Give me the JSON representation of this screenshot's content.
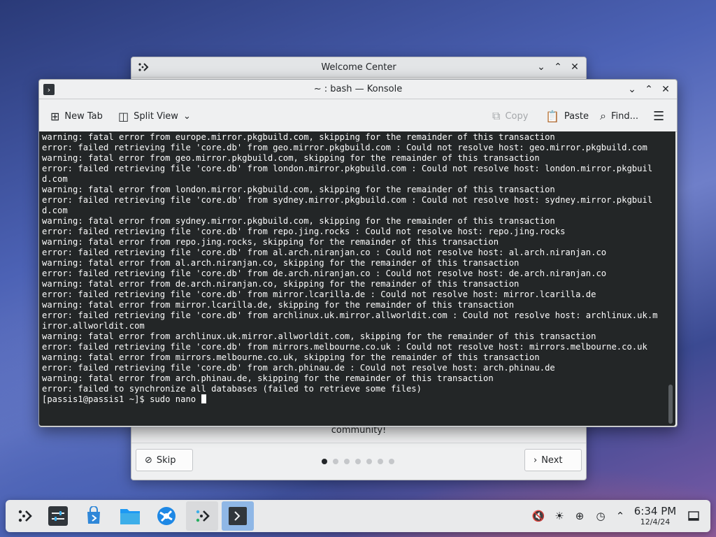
{
  "welcome": {
    "title": "Welcome Center",
    "visible_text": "community!",
    "skip_label": "Skip",
    "next_label": "Next",
    "pages": 7,
    "current_page": 1
  },
  "konsole": {
    "title": "~ : bash — Konsole",
    "toolbar": {
      "new_tab": "New Tab",
      "split_view": "Split View",
      "copy": "Copy",
      "paste": "Paste",
      "find": "Find..."
    },
    "terminal_lines": [
      "warning: fatal error from europe.mirror.pkgbuild.com, skipping for the remainder of this transaction",
      "error: failed retrieving file 'core.db' from geo.mirror.pkgbuild.com : Could not resolve host: geo.mirror.pkgbuild.com",
      "warning: fatal error from geo.mirror.pkgbuild.com, skipping for the remainder of this transaction",
      "error: failed retrieving file 'core.db' from london.mirror.pkgbuild.com : Could not resolve host: london.mirror.pkgbuild.com",
      "warning: fatal error from london.mirror.pkgbuild.com, skipping for the remainder of this transaction",
      "error: failed retrieving file 'core.db' from sydney.mirror.pkgbuild.com : Could not resolve host: sydney.mirror.pkgbuild.com",
      "warning: fatal error from sydney.mirror.pkgbuild.com, skipping for the remainder of this transaction",
      "error: failed retrieving file 'core.db' from repo.jing.rocks : Could not resolve host: repo.jing.rocks",
      "warning: fatal error from repo.jing.rocks, skipping for the remainder of this transaction",
      "error: failed retrieving file 'core.db' from al.arch.niranjan.co : Could not resolve host: al.arch.niranjan.co",
      "warning: fatal error from al.arch.niranjan.co, skipping for the remainder of this transaction",
      "error: failed retrieving file 'core.db' from de.arch.niranjan.co : Could not resolve host: de.arch.niranjan.co",
      "warning: fatal error from de.arch.niranjan.co, skipping for the remainder of this transaction",
      "error: failed retrieving file 'core.db' from mirror.lcarilla.de : Could not resolve host: mirror.lcarilla.de",
      "warning: fatal error from mirror.lcarilla.de, skipping for the remainder of this transaction",
      "error: failed retrieving file 'core.db' from archlinux.uk.mirror.allworldit.com : Could not resolve host: archlinux.uk.mirror.allworldit.com",
      "warning: fatal error from archlinux.uk.mirror.allworldit.com, skipping for the remainder of this transaction",
      "error: failed retrieving file 'core.db' from mirrors.melbourne.co.uk : Could not resolve host: mirrors.melbourne.co.uk",
      "warning: fatal error from mirrors.melbourne.co.uk, skipping for the remainder of this transaction",
      "error: failed retrieving file 'core.db' from arch.phinau.de : Could not resolve host: arch.phinau.de",
      "warning: fatal error from arch.phinau.de, skipping for the remainder of this transaction",
      "error: failed to synchronize all databases (failed to retrieve some files)"
    ],
    "prompt": "[passis1@passis1 ~]$ sudo nano "
  },
  "taskbar": {
    "apps": [
      "application-launcher-icon",
      "system-settings-icon",
      "discover-store-icon",
      "file-manager-icon",
      "browser-icon",
      "welcome-center-icon",
      "konsole-icon"
    ],
    "tray": [
      "volume-muted-icon",
      "brightness-icon",
      "network-icon",
      "updates-icon",
      "chevron-up-icon"
    ],
    "time": "6:34 PM",
    "date": "12/4/24"
  },
  "colors": {
    "terminal_bg": "#232627",
    "terminal_fg": "#fcfcfc",
    "active_task": "#8fb7e6"
  }
}
